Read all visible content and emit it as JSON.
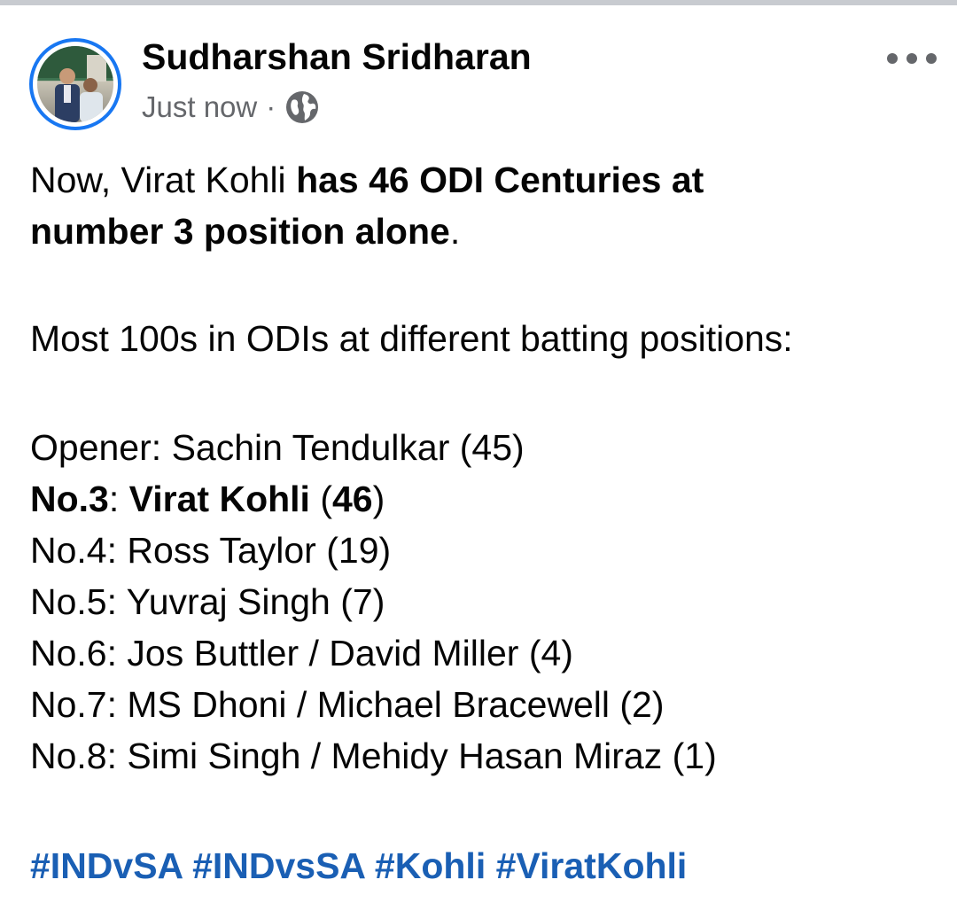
{
  "post": {
    "author": "Sudharshan Sridharan",
    "time": "Just now",
    "separator": "·",
    "audience_icon": "globe-icon",
    "menu_icon": "more-horizontal-icon",
    "intro": {
      "prefix": "Now, Virat Kohli ",
      "bold_line1": "has 46 ODI Centuries at",
      "bold_line2": "number 3 position alone",
      "suffix": "."
    },
    "list_heading": "Most 100s in ODIs at different batting positions:",
    "entries": [
      {
        "position": "Opener",
        "player": "Sachin Tendulkar",
        "count": "45"
      },
      {
        "position": "No.3",
        "player": "Virat Kohli",
        "count": "46"
      },
      {
        "position": "No.4",
        "player": "Ross Taylor",
        "count": "19"
      },
      {
        "position": "No.5",
        "player": "Yuvraj Singh",
        "count": "7"
      },
      {
        "position": "No.6",
        "player": "Jos Buttler / David Miller",
        "count": "4"
      },
      {
        "position": "No.7",
        "player": "MS Dhoni / Michael Bracewell",
        "count": "2"
      },
      {
        "position": "No.8",
        "player": "Simi Singh / Mehidy Hasan Miraz",
        "count": "1"
      }
    ],
    "hashtags": [
      "#INDvSA",
      "#INDvsSA",
      "#Kohli",
      "#ViratKohli"
    ]
  },
  "colors": {
    "accent": "#1877f2",
    "hashtag": "#1a5fb4",
    "secondary_text": "#65676b",
    "primary_text": "#050505"
  }
}
